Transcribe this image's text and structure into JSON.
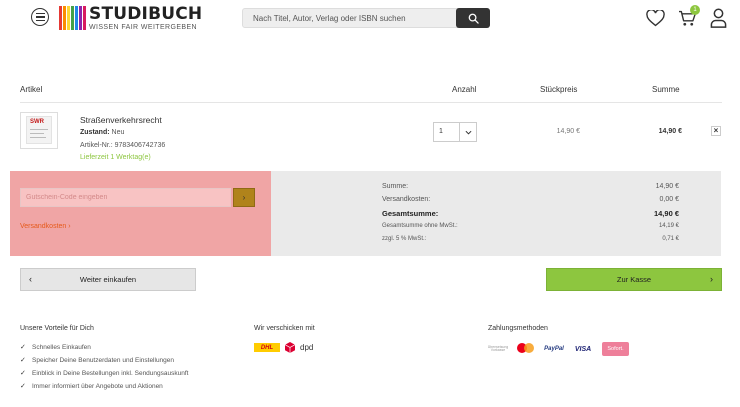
{
  "header": {
    "logo_title": "STUDIBUCH",
    "logo_subtitle": "WISSEN FAIR WEITERGEBEN",
    "search_placeholder": "Nach Titel, Autor, Verlag oder ISBN suchen",
    "cart_count": "1",
    "logo_colors": [
      "#e53935",
      "#fb8c00",
      "#fdd835",
      "#43a047",
      "#1e88e5",
      "#8e24aa",
      "#d81b60"
    ]
  },
  "table": {
    "headers": {
      "article": "Artikel",
      "quantity": "Anzahl",
      "unit_price": "Stückpreis",
      "sum": "Summe"
    }
  },
  "item": {
    "cover_logo": "SWR",
    "title": "Straßenverkehrsrecht",
    "condition_label": "Zustand:",
    "condition_value": "Neu",
    "article_number": "Artikel-Nr.: 9783406742736",
    "delivery": "Lieferzeit 1 Werktag(e)",
    "quantity": "1",
    "unit_price": "14,90 €",
    "total": "14,90 €",
    "remove_label": "×"
  },
  "coupon": {
    "placeholder": "Gutschein-Code eingeben",
    "submit_label": "›",
    "shipping_link": "Versandkosten ›"
  },
  "summary": {
    "rows": [
      {
        "label": "Summe:",
        "value": "14,90 €"
      },
      {
        "label": "Versandkosten:",
        "value": "0,00 €"
      },
      {
        "label": "Gesamtsumme:",
        "value": "14,90 €"
      },
      {
        "label": "Gesamtsumme ohne MwSt.:",
        "value": "14,19 €"
      },
      {
        "label": "zzgl. 5 % MwSt.:",
        "value": "0,71 €"
      }
    ]
  },
  "actions": {
    "continue_label": "Weiter einkaufen",
    "continue_chevron": "‹",
    "checkout_label": "Zur Kasse",
    "checkout_chevron": "›"
  },
  "footer": {
    "benefits_title": "Unsere Vorteile für Dich",
    "check_mark": "✓",
    "benefits": [
      "Schnelles Einkaufen",
      "Speicher Deine Benutzerdaten und Einstellungen",
      "Einblick in Deine Bestellungen inkl. Sendungsauskunft",
      "Immer informiert über Angebote und Aktionen"
    ],
    "shipping_title": "Wir verschicken mit",
    "shipping_carriers": [
      "DHL",
      "dpd"
    ],
    "payment_title": "Zahlungsmethoden",
    "payment_methods": [
      "Überweisung Vorkasse",
      "Mastercard",
      "PayPal",
      "VISA",
      "Sofort."
    ]
  }
}
